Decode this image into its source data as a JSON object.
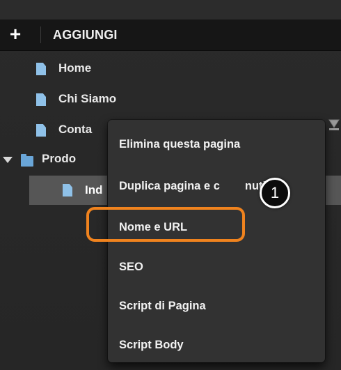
{
  "toolbar": {
    "add_symbol": "+",
    "add_label": "AGGIUNGI"
  },
  "tree": {
    "items": [
      {
        "label": "Home",
        "icon": "document-icon"
      },
      {
        "label": "Chi Siamo",
        "icon": "document-icon"
      },
      {
        "label": "Conta",
        "icon": "document-icon"
      },
      {
        "label": "Prodo",
        "icon": "folder-icon",
        "expanded": true
      },
      {
        "label": "Ind",
        "icon": "document-icon",
        "selected": true
      }
    ]
  },
  "context_menu": {
    "items": [
      "Elimina questa pagina",
      "Duplica pagina e c",
      "Nome e URL",
      "SEO",
      "Script di Pagina",
      "Script Body"
    ],
    "partial_text": "nuti",
    "highlighted_item": "Nome e URL"
  },
  "callout": {
    "number": "1"
  },
  "colors": {
    "highlight": "#f0831e",
    "doc_icon": "#8fc1e8",
    "folder_icon": "#6aa6d8",
    "selected_row": "#565656"
  }
}
